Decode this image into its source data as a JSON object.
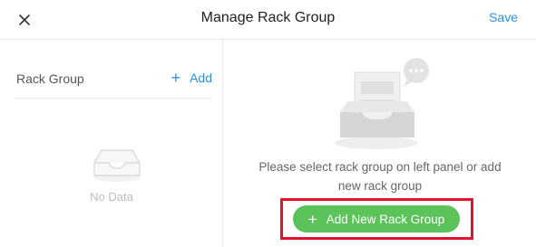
{
  "header": {
    "title": "Manage Rack Group",
    "save_label": "Save",
    "close_icon": "close-icon"
  },
  "left_panel": {
    "label": "Rack Group",
    "add_icon": "plus-icon",
    "add_label": "Add",
    "empty_icon": "empty-tray-icon",
    "empty_text": "No Data"
  },
  "right_panel": {
    "illustration": "empty-inbox-chat-illustration",
    "hint_line1": "Please select rack group on left panel or add",
    "hint_line2": "new rack group",
    "add_button_icon": "plus-icon",
    "add_button_label": "Add New Rack Group"
  },
  "colors": {
    "accent_blue": "#2b8fe6",
    "button_green": "#5cc35b",
    "highlight_red": "#e5102a"
  }
}
